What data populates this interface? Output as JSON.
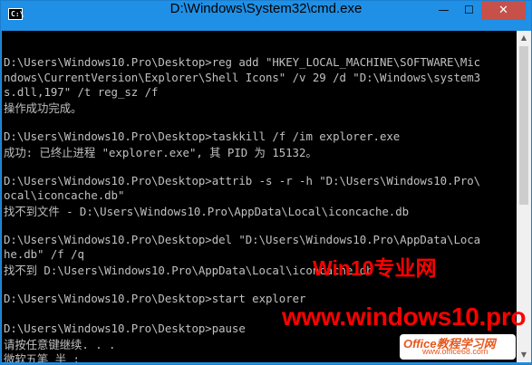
{
  "window": {
    "title": "D:\\Windows\\System32\\cmd.exe",
    "icon": "cmd-icon",
    "icon_text": "C:\\",
    "controls": {
      "minimize": "—",
      "maximize": "☐",
      "close": "✕"
    }
  },
  "console": {
    "lines": [
      "",
      "D:\\Users\\Windows10.Pro\\Desktop>reg add \"HKEY_LOCAL_MACHINE\\SOFTWARE\\Mic",
      "ndows\\CurrentVersion\\Explorer\\Shell Icons\" /v 29 /d \"D:\\Windows\\system3",
      "s.dll,197\" /t reg_sz /f",
      "操作成功完成。",
      "",
      "D:\\Users\\Windows10.Pro\\Desktop>taskkill /f /im explorer.exe",
      "成功: 已终止进程 \"explorer.exe\", 其 PID 为 15132。",
      "",
      "D:\\Users\\Windows10.Pro\\Desktop>attrib -s -r -h \"D:\\Users\\Windows10.Pro\\",
      "ocal\\iconcache.db\"",
      "找不到文件 - D:\\Users\\Windows10.Pro\\AppData\\Local\\iconcache.db",
      "",
      "D:\\Users\\Windows10.Pro\\Desktop>del \"D:\\Users\\Windows10.Pro\\AppData\\Loca",
      "he.db\" /f /q",
      "找不到 D:\\Users\\Windows10.Pro\\AppData\\Local\\iconcache.db",
      "",
      "D:\\Users\\Windows10.Pro\\Desktop>start explorer",
      "",
      "D:\\Users\\Windows10.Pro\\Desktop>pause",
      "请按任意键继续. . .",
      "微软五笔 半 :"
    ]
  },
  "scrollbar": {
    "up": "▲",
    "down": "▼"
  },
  "watermarks": {
    "site_name": "Win10专业网",
    "site_url": "www.windows10.pro",
    "office_brand": "Office教程学习网",
    "office_url": "www.office68.com"
  },
  "colors": {
    "titlebar": "#1f90e6",
    "close_button": "#c7504a",
    "console_background": "#000000",
    "console_text": "#c0c0c0",
    "watermark": "#ff0000"
  }
}
